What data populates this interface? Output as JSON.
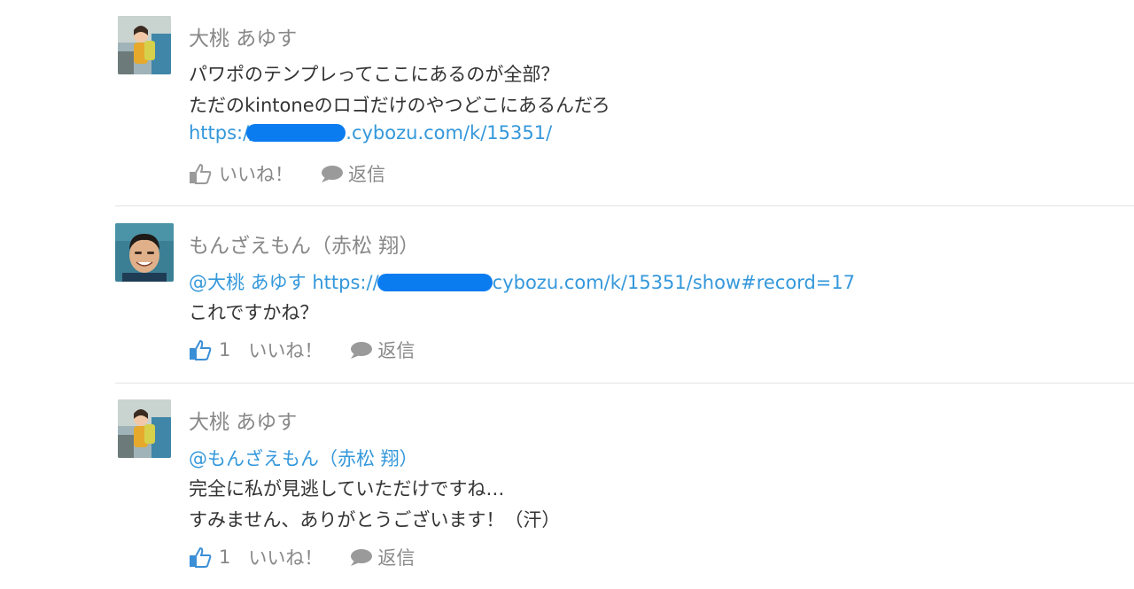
{
  "comments": [
    {
      "author": "大桃 あゆす",
      "lines": [
        "パワポのテンプレってここにあるのが全部？",
        "ただのkintoneのロゴだけのやつどこにあるんだろ"
      ],
      "link_prefix": "https://",
      "link_suffix": ".cybozu.com/k/15351/",
      "likes": "",
      "like_label": "いいね！",
      "reply_label": "返信"
    },
    {
      "author": "もんざえもん（赤松 翔）",
      "mention": "@大桃 あゆす",
      "link_prefix": "https://",
      "link_suffix": "cybozu.com/k/15351/show#record=17",
      "lines": [
        "これですかね？"
      ],
      "likes": "1",
      "like_label": "いいね！",
      "reply_label": "返信"
    },
    {
      "author": "大桃 あゆす",
      "mention": "@もんざえもん（赤松 翔）",
      "lines": [
        "完全に私が見逃していただけですね…",
        "すみません、ありがとうございます！（汗）"
      ],
      "likes": "1",
      "like_label": "いいね！",
      "reply_label": "返信"
    }
  ],
  "colors": {
    "link": "#3498db",
    "like_active": "#3b8fd6",
    "like_inactive": "#9a9a9a",
    "redaction": "#0a7cf0"
  }
}
